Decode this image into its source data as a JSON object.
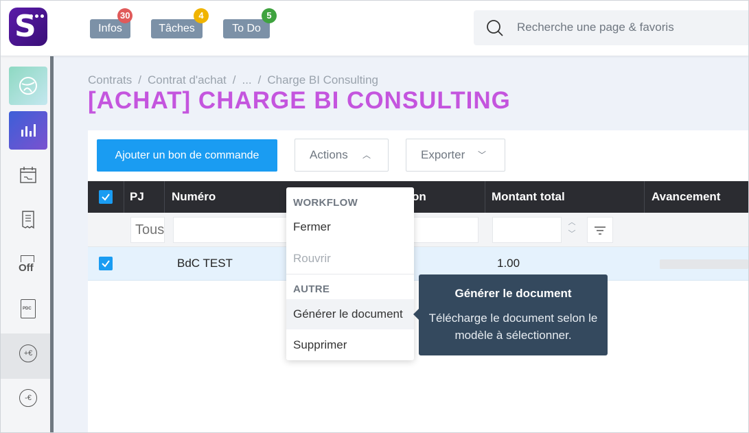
{
  "app": {
    "logo_letter": "S"
  },
  "topbar": {
    "pills": [
      {
        "label": "Infos",
        "badge": "30",
        "badge_color": "#e05a5a"
      },
      {
        "label": "Tâches",
        "badge": "4",
        "badge_color": "#f0b400"
      },
      {
        "label": "To Do",
        "badge": "5",
        "badge_color": "#3fa33f"
      }
    ],
    "search": {
      "placeholder": "Recherche une page & favoris",
      "icon": "search-icon"
    }
  },
  "sidebar": {
    "items": [
      {
        "name": "globe-app-icon"
      },
      {
        "name": "chart-bar-icon"
      },
      {
        "name": "calendar-icon"
      },
      {
        "name": "receipt-icon"
      },
      {
        "name": "off-icon",
        "text": "Off"
      },
      {
        "name": "pdc-document-icon",
        "text": "PDC"
      },
      {
        "name": "plus-euro-icon",
        "text": "+€",
        "active": true
      },
      {
        "name": "minus-euro-icon",
        "text": "-€"
      }
    ]
  },
  "breadcrumb": [
    "Contrats",
    "Contrat d'achat",
    "...",
    "Charge BI Consulting"
  ],
  "page_title": "[ACHAT] CHARGE BI CONSULTING",
  "toolbar": {
    "add_label": "Ajouter un bon de commande",
    "actions_label": "Actions",
    "export_label": "Exporter"
  },
  "table": {
    "headers": {
      "pj": "PJ",
      "numero": "Numéro",
      "designation": "on",
      "montant": "Montant total",
      "avancement": "Avancement"
    },
    "filter": {
      "pj_placeholder": "Tous"
    },
    "rows": [
      {
        "checked": true,
        "numero": "BdC TEST",
        "montant": "1.00"
      }
    ]
  },
  "dropdown": {
    "sections": [
      {
        "header": "WORKFLOW",
        "items": [
          {
            "label": "Fermer",
            "disabled": false
          },
          {
            "label": "Rouvrir",
            "disabled": true
          }
        ]
      },
      {
        "header": "AUTRE",
        "items": [
          {
            "label": "Générer le document",
            "highlighted": true
          },
          {
            "label": "Supprimer"
          }
        ]
      }
    ]
  },
  "tooltip": {
    "title": "Générer le document",
    "description": "Télécharge le document selon le modèle à sélectionner."
  },
  "colors": {
    "primary": "#1a9cf2",
    "title": "#c455de",
    "header_bg": "#2b2c31",
    "tooltip_bg": "#34495e"
  }
}
